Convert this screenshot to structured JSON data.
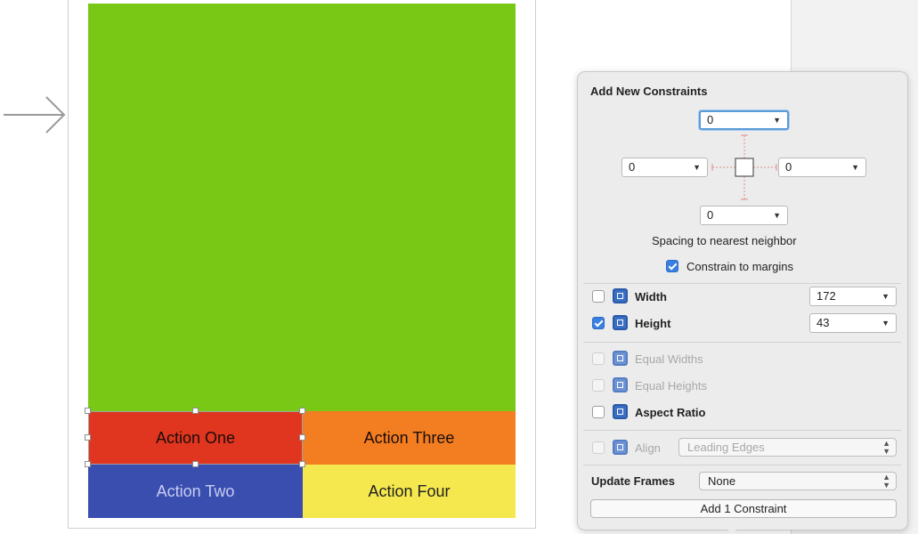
{
  "canvas": {
    "buttons": {
      "action_one": "Action One",
      "action_two": "Action Two",
      "action_three": "Action Three",
      "action_four": "Action Four"
    },
    "colors": {
      "main_view": "#79c815",
      "action_one": "#e0351f",
      "action_two": "#3a4eb0",
      "action_three": "#f37d21",
      "action_four": "#f5e84e"
    }
  },
  "popover": {
    "title": "Add New Constraints",
    "spacing": {
      "top": "0",
      "left": "0",
      "right": "0",
      "bottom": "0",
      "caption": "Spacing to nearest neighbor"
    },
    "constrain_to_margins": {
      "label": "Constrain to margins",
      "checked": true
    },
    "size": {
      "width": {
        "label": "Width",
        "value": "172",
        "checked": false
      },
      "height": {
        "label": "Height",
        "value": "43",
        "checked": true
      }
    },
    "equal": {
      "equal_widths": "Equal Widths",
      "equal_heights": "Equal Heights",
      "aspect_ratio": "Aspect Ratio"
    },
    "align": {
      "label": "Align",
      "value": "Leading Edges"
    },
    "update_frames": {
      "label": "Update Frames",
      "value": "None"
    },
    "add_button": "Add 1 Constraint"
  },
  "icons": [
    "entry-arrow-icon",
    "dropdown-caret-icon",
    "width-icon",
    "height-icon",
    "equal-widths-icon",
    "equal-heights-icon",
    "aspect-ratio-icon",
    "align-icon",
    "spacing-diagram-icon"
  ]
}
